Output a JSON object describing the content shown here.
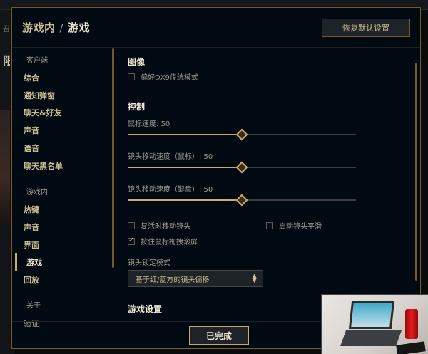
{
  "background": {
    "top_left_text": "召",
    "left_title": "限"
  },
  "header": {
    "breadcrumb_parent": "游戏内",
    "breadcrumb_sep": "/",
    "breadcrumb_current": "游戏",
    "reset_label": "恢复默认设置"
  },
  "sidebar": {
    "section_client": "客户端",
    "client_items": [
      "综合",
      "通知弹窗",
      "聊天&好友",
      "声音",
      "语音",
      "聊天黑名单"
    ],
    "section_ingame": "游戏内",
    "ingame_items": [
      "热键",
      "声音",
      "界面",
      "游戏",
      "回放"
    ],
    "active_item": "游戏",
    "section_about": "关于",
    "about_items": [
      "验证"
    ]
  },
  "content": {
    "graphics_title": "图像",
    "dx9_label": "偏好DX9传统模式",
    "dx9_checked": false,
    "control_title": "控制",
    "mouse_speed_label": "鼠标速度: 50",
    "mouse_speed_value": 50,
    "camera_mouse_label": "镜头移动速度（鼠标）: 50",
    "camera_mouse_value": 50,
    "camera_keyboard_label": "镜头移动速度（键盘）: 50",
    "camera_keyboard_value": 50,
    "revive_camera_label": "复活时移动镜头",
    "revive_camera_checked": false,
    "smooth_camera_label": "启动镜头平滑",
    "smooth_camera_checked": false,
    "drag_scroll_label": "按住鼠标拖拽滚屏",
    "drag_scroll_checked": true,
    "camera_lock_label": "镜头锁定模式",
    "camera_lock_value": "基于红/蓝方的镜头偏移",
    "game_settings_title": "游戏设置"
  },
  "footer": {
    "done_label": "已完成"
  },
  "colors": {
    "gold": "#c8aa6e",
    "border_gold": "#785a28",
    "bg": "#010a13"
  }
}
